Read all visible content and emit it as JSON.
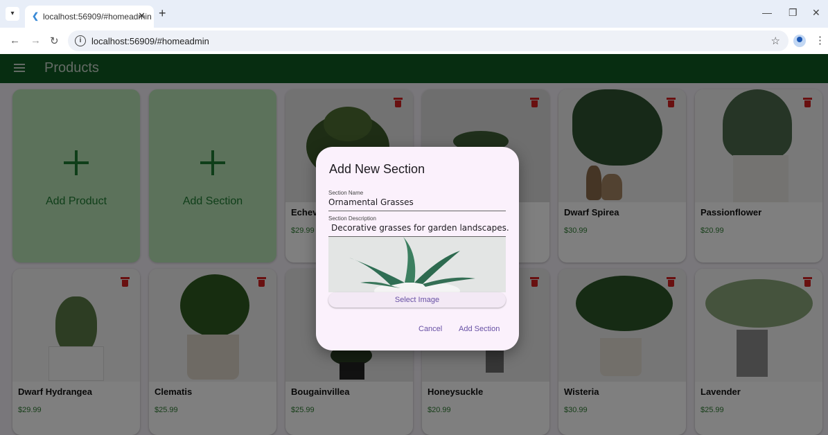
{
  "browser": {
    "tab_title": "localhost:56909/#homeadmin",
    "url": "localhost:56909/#homeadmin"
  },
  "app": {
    "title": "Products"
  },
  "add_tiles": [
    {
      "label": "Add Product"
    },
    {
      "label": "Add Section"
    }
  ],
  "products_row1": [
    {
      "name": "Echeveria",
      "price": "$29.99"
    },
    {
      "name": "",
      "price": ""
    },
    {
      "name": "Dwarf Spirea",
      "price": "$30.99"
    },
    {
      "name": "Passionflower",
      "price": "$20.99"
    }
  ],
  "products_row2": [
    {
      "name": "Dwarf Hydrangea",
      "price": "$29.99"
    },
    {
      "name": "Clematis",
      "price": "$25.99"
    },
    {
      "name": "Bougainvillea",
      "price": "$25.99"
    },
    {
      "name": "Honeysuckle",
      "price": "$20.99"
    },
    {
      "name": "Wisteria",
      "price": "$30.99"
    },
    {
      "name": "Lavender",
      "price": "$25.99"
    }
  ],
  "dialog": {
    "title": "Add New Section",
    "section_name_label": "Section Name",
    "section_name_value": "Ornamental Grasses",
    "section_desc_label": "Section Description",
    "section_desc_value": "Decorative grasses for garden landscapes.",
    "select_image_label": "Select Image",
    "cancel_label": "Cancel",
    "add_label": "Add Section"
  },
  "colors": {
    "app_bar": "#0e5a23",
    "add_tile": "#b8e4b7",
    "accent": "#6750a4",
    "delete": "#d32020",
    "price": "#2e7d32"
  }
}
